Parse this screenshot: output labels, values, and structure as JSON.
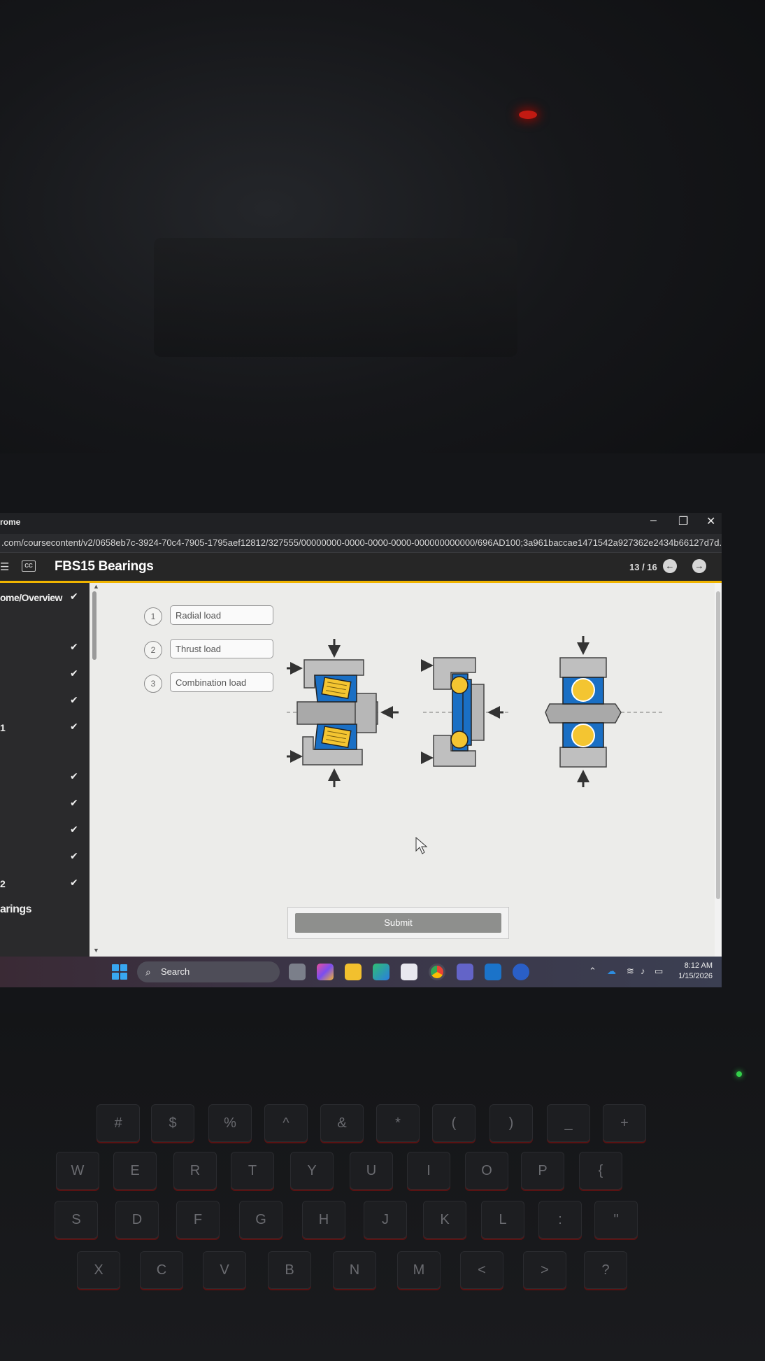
{
  "browser": {
    "app_name": "rome",
    "url": ".com/coursecontent/v2/0658eb7c-3924-70c4-7905-1795aef12812/327555/00000000-0000-0000-0000-000000000000/696AD100;3a961baccae1471542a927362e2434b66127d7d...",
    "controls": {
      "minimize": "–",
      "restore": "❐",
      "close": "✕"
    }
  },
  "course": {
    "title": "FBS15 Bearings",
    "page_counter": "13 / 16",
    "prev_icon": "arrow-left-icon",
    "next_icon": "arrow-right-icon",
    "cc_label": "CC"
  },
  "sidebar": {
    "items": [
      {
        "label": "ome/Overview",
        "check": "✔"
      },
      {
        "label": "",
        "check": "✔"
      },
      {
        "label": "",
        "check": "✔"
      },
      {
        "label": "",
        "check": "✔"
      },
      {
        "label": "1",
        "check": "✔"
      },
      {
        "label": "",
        "check": "✔"
      },
      {
        "label": "",
        "check": "✔"
      },
      {
        "label": "",
        "check": "✔"
      },
      {
        "label": "",
        "check": "✔"
      },
      {
        "label": "2",
        "check": "✔"
      },
      {
        "label": "arings",
        "check": ""
      }
    ]
  },
  "activity": {
    "load_types": [
      {
        "number": "1",
        "label": "Radial load"
      },
      {
        "number": "2",
        "label": "Thrust load"
      },
      {
        "number": "3",
        "label": "Combination load"
      }
    ],
    "submit_label": "Submit",
    "diagrams": [
      "tapered-roller-bearing-diagram",
      "thrust-ball-bearing-diagram",
      "radial-ball-bearing-diagram"
    ],
    "colors": {
      "race_blue": "#1a6fc4",
      "roller_yellow": "#f4c531",
      "housing_gray": "#bfbfbf",
      "shaft_gray": "#a9a9a9"
    }
  },
  "taskbar": {
    "search_label": "Search",
    "time": "8:12 AM",
    "date": "1/15/2026"
  }
}
